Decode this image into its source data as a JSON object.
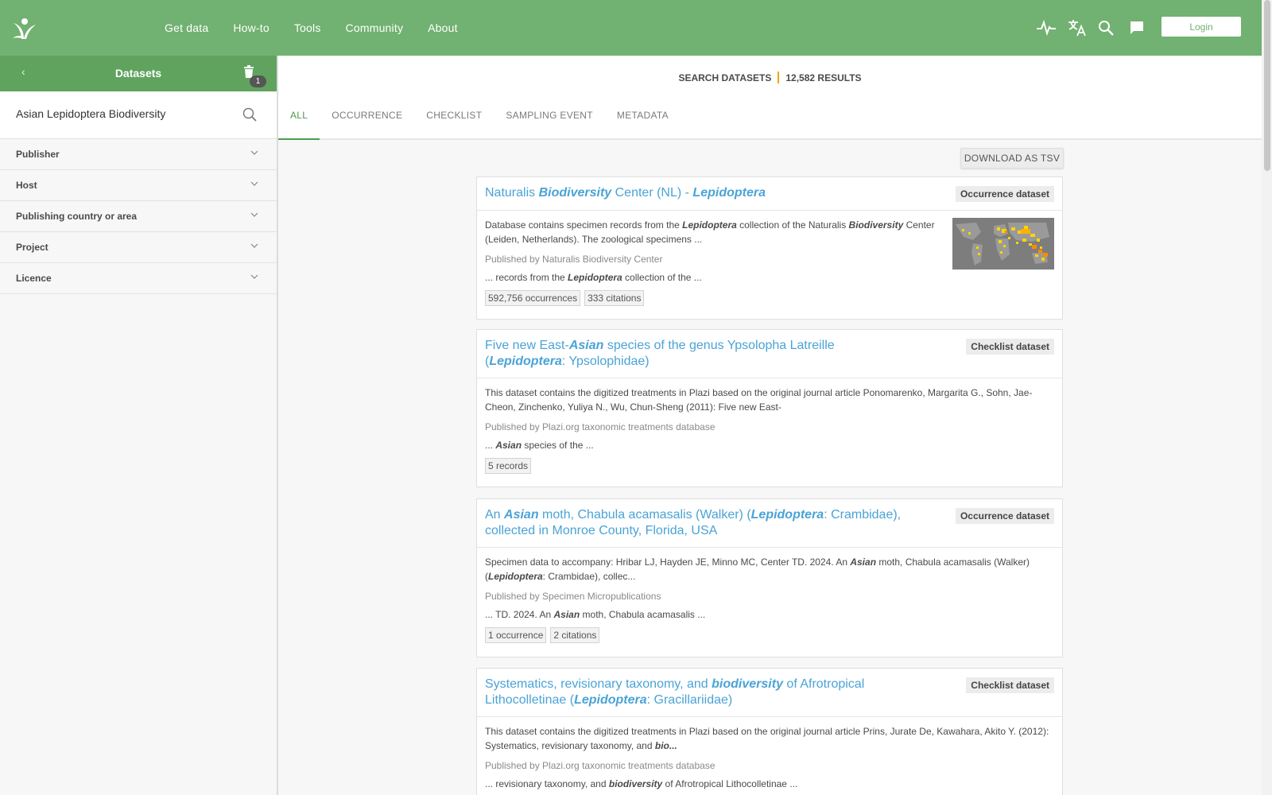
{
  "nav": {
    "items": [
      "Get data",
      "How-to",
      "Tools",
      "Community",
      "About"
    ],
    "login_label": "Login",
    "icons": [
      "activity-icon",
      "translate-icon",
      "search-icon",
      "feedback-icon"
    ]
  },
  "sidebar": {
    "title": "Datasets",
    "filter_count": "1",
    "search_value": "Asian Lepidoptera Biodiversity",
    "facets": [
      "Publisher",
      "Host",
      "Publishing country or area",
      "Project",
      "Licence"
    ]
  },
  "results": {
    "label": "SEARCH DATASETS",
    "count": "12,582 RESULTS"
  },
  "tabs": [
    "ALL",
    "OCCURRENCE",
    "CHECKLIST",
    "SAMPLING EVENT",
    "METADATA"
  ],
  "download_label": "DOWNLOAD AS TSV",
  "cards": [
    {
      "title": [
        {
          "t": "Naturalis "
        },
        {
          "t": "Biodiversity",
          "em": true
        },
        {
          "t": " Center (NL) - "
        },
        {
          "t": "Lepidoptera",
          "em": true
        }
      ],
      "type": "Occurrence dataset",
      "desc": [
        {
          "t": "Database contains specimen records from the "
        },
        {
          "t": "Lepidoptera",
          "em": true
        },
        {
          "t": " collection of the Naturalis "
        },
        {
          "t": "Biodiversity",
          "em": true
        },
        {
          "t": " Center (Leiden, Netherlands). The zoological specimens ..."
        }
      ],
      "publisher": "Published by Naturalis Biodiversity Center",
      "snippet": [
        {
          "t": "... records from the "
        },
        {
          "t": "Lepidoptera",
          "em": true
        },
        {
          "t": " collection of the ..."
        }
      ],
      "chips": [
        "592,756 occurrences",
        "333 citations"
      ],
      "has_map": true
    },
    {
      "title": [
        {
          "t": "Five new East-"
        },
        {
          "t": "Asian",
          "em": true
        },
        {
          "t": " species of the genus Ypsolopha Latreille ("
        },
        {
          "t": "Lepidoptera",
          "em": true
        },
        {
          "t": ": Ypsolophidae)"
        }
      ],
      "type": "Checklist dataset",
      "desc": [
        {
          "t": "This dataset contains the digitized treatments in Plazi based on the original journal article Ponomarenko, Margarita G., Sohn, Jae-Cheon, Zinchenko, Yuliya N., Wu, Chun-Sheng (2011): Five new East-"
        }
      ],
      "publisher": "Published by Plazi.org taxonomic treatments database",
      "snippet": [
        {
          "t": "... "
        },
        {
          "t": "Asian",
          "em": true
        },
        {
          "t": " species of the ..."
        }
      ],
      "chips": [
        "5 records"
      ],
      "has_map": false
    },
    {
      "title": [
        {
          "t": "An "
        },
        {
          "t": "Asian",
          "em": true
        },
        {
          "t": " moth, Chabula acamasalis (Walker) ("
        },
        {
          "t": "Lepidoptera",
          "em": true
        },
        {
          "t": ": Crambidae), collected in Monroe County, Florida, USA"
        }
      ],
      "type": "Occurrence dataset",
      "desc": [
        {
          "t": "Specimen data to accompany: Hribar LJ, Hayden JE, Minno MC, Center TD. 2024. An "
        },
        {
          "t": "Asian",
          "em": true
        },
        {
          "t": " moth, Chabula acamasalis (Walker) ("
        },
        {
          "t": "Lepidoptera",
          "em": true
        },
        {
          "t": ": Crambidae), collec..."
        }
      ],
      "publisher": "Published by Specimen Micropublications",
      "snippet": [
        {
          "t": "... TD. 2024. An "
        },
        {
          "t": "Asian",
          "em": true
        },
        {
          "t": " moth, Chabula acamasalis ..."
        }
      ],
      "chips": [
        "1 occurrence",
        "2 citations"
      ],
      "has_map": false
    },
    {
      "title": [
        {
          "t": "Systematics, revisionary taxonomy, and "
        },
        {
          "t": "biodiversity",
          "em": true
        },
        {
          "t": " of Afrotropical Lithocolletinae ("
        },
        {
          "t": "Lepidoptera",
          "em": true
        },
        {
          "t": ": Gracillariidae)"
        }
      ],
      "type": "Checklist dataset",
      "desc": [
        {
          "t": "This dataset contains the digitized treatments in Plazi based on the original journal article Prins, Jurate De, Kawahara, Akito Y. (2012): Systematics, revisionary taxonomy, and "
        },
        {
          "t": "bio...",
          "em": true
        }
      ],
      "publisher": "Published by Plazi.org taxonomic treatments database",
      "snippet": [
        {
          "t": "... revisionary taxonomy, and "
        },
        {
          "t": "biodiversity",
          "em": true
        },
        {
          "t": " of Afrotropical Lithocolletinae ..."
        }
      ],
      "chips": [],
      "has_map": false
    }
  ]
}
